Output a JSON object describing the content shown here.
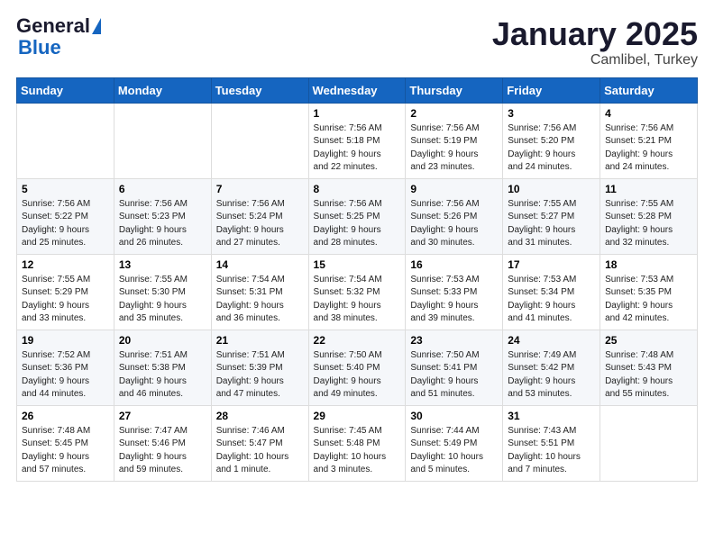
{
  "header": {
    "logo_general": "General",
    "logo_blue": "Blue",
    "title": "January 2025",
    "location": "Camlibel, Turkey"
  },
  "days_of_week": [
    "Sunday",
    "Monday",
    "Tuesday",
    "Wednesday",
    "Thursday",
    "Friday",
    "Saturday"
  ],
  "weeks": [
    [
      {
        "day": "",
        "info": ""
      },
      {
        "day": "",
        "info": ""
      },
      {
        "day": "",
        "info": ""
      },
      {
        "day": "1",
        "info": "Sunrise: 7:56 AM\nSunset: 5:18 PM\nDaylight: 9 hours\nand 22 minutes."
      },
      {
        "day": "2",
        "info": "Sunrise: 7:56 AM\nSunset: 5:19 PM\nDaylight: 9 hours\nand 23 minutes."
      },
      {
        "day": "3",
        "info": "Sunrise: 7:56 AM\nSunset: 5:20 PM\nDaylight: 9 hours\nand 24 minutes."
      },
      {
        "day": "4",
        "info": "Sunrise: 7:56 AM\nSunset: 5:21 PM\nDaylight: 9 hours\nand 24 minutes."
      }
    ],
    [
      {
        "day": "5",
        "info": "Sunrise: 7:56 AM\nSunset: 5:22 PM\nDaylight: 9 hours\nand 25 minutes."
      },
      {
        "day": "6",
        "info": "Sunrise: 7:56 AM\nSunset: 5:23 PM\nDaylight: 9 hours\nand 26 minutes."
      },
      {
        "day": "7",
        "info": "Sunrise: 7:56 AM\nSunset: 5:24 PM\nDaylight: 9 hours\nand 27 minutes."
      },
      {
        "day": "8",
        "info": "Sunrise: 7:56 AM\nSunset: 5:25 PM\nDaylight: 9 hours\nand 28 minutes."
      },
      {
        "day": "9",
        "info": "Sunrise: 7:56 AM\nSunset: 5:26 PM\nDaylight: 9 hours\nand 30 minutes."
      },
      {
        "day": "10",
        "info": "Sunrise: 7:55 AM\nSunset: 5:27 PM\nDaylight: 9 hours\nand 31 minutes."
      },
      {
        "day": "11",
        "info": "Sunrise: 7:55 AM\nSunset: 5:28 PM\nDaylight: 9 hours\nand 32 minutes."
      }
    ],
    [
      {
        "day": "12",
        "info": "Sunrise: 7:55 AM\nSunset: 5:29 PM\nDaylight: 9 hours\nand 33 minutes."
      },
      {
        "day": "13",
        "info": "Sunrise: 7:55 AM\nSunset: 5:30 PM\nDaylight: 9 hours\nand 35 minutes."
      },
      {
        "day": "14",
        "info": "Sunrise: 7:54 AM\nSunset: 5:31 PM\nDaylight: 9 hours\nand 36 minutes."
      },
      {
        "day": "15",
        "info": "Sunrise: 7:54 AM\nSunset: 5:32 PM\nDaylight: 9 hours\nand 38 minutes."
      },
      {
        "day": "16",
        "info": "Sunrise: 7:53 AM\nSunset: 5:33 PM\nDaylight: 9 hours\nand 39 minutes."
      },
      {
        "day": "17",
        "info": "Sunrise: 7:53 AM\nSunset: 5:34 PM\nDaylight: 9 hours\nand 41 minutes."
      },
      {
        "day": "18",
        "info": "Sunrise: 7:53 AM\nSunset: 5:35 PM\nDaylight: 9 hours\nand 42 minutes."
      }
    ],
    [
      {
        "day": "19",
        "info": "Sunrise: 7:52 AM\nSunset: 5:36 PM\nDaylight: 9 hours\nand 44 minutes."
      },
      {
        "day": "20",
        "info": "Sunrise: 7:51 AM\nSunset: 5:38 PM\nDaylight: 9 hours\nand 46 minutes."
      },
      {
        "day": "21",
        "info": "Sunrise: 7:51 AM\nSunset: 5:39 PM\nDaylight: 9 hours\nand 47 minutes."
      },
      {
        "day": "22",
        "info": "Sunrise: 7:50 AM\nSunset: 5:40 PM\nDaylight: 9 hours\nand 49 minutes."
      },
      {
        "day": "23",
        "info": "Sunrise: 7:50 AM\nSunset: 5:41 PM\nDaylight: 9 hours\nand 51 minutes."
      },
      {
        "day": "24",
        "info": "Sunrise: 7:49 AM\nSunset: 5:42 PM\nDaylight: 9 hours\nand 53 minutes."
      },
      {
        "day": "25",
        "info": "Sunrise: 7:48 AM\nSunset: 5:43 PM\nDaylight: 9 hours\nand 55 minutes."
      }
    ],
    [
      {
        "day": "26",
        "info": "Sunrise: 7:48 AM\nSunset: 5:45 PM\nDaylight: 9 hours\nand 57 minutes."
      },
      {
        "day": "27",
        "info": "Sunrise: 7:47 AM\nSunset: 5:46 PM\nDaylight: 9 hours\nand 59 minutes."
      },
      {
        "day": "28",
        "info": "Sunrise: 7:46 AM\nSunset: 5:47 PM\nDaylight: 10 hours\nand 1 minute."
      },
      {
        "day": "29",
        "info": "Sunrise: 7:45 AM\nSunset: 5:48 PM\nDaylight: 10 hours\nand 3 minutes."
      },
      {
        "day": "30",
        "info": "Sunrise: 7:44 AM\nSunset: 5:49 PM\nDaylight: 10 hours\nand 5 minutes."
      },
      {
        "day": "31",
        "info": "Sunrise: 7:43 AM\nSunset: 5:51 PM\nDaylight: 10 hours\nand 7 minutes."
      },
      {
        "day": "",
        "info": ""
      }
    ]
  ]
}
